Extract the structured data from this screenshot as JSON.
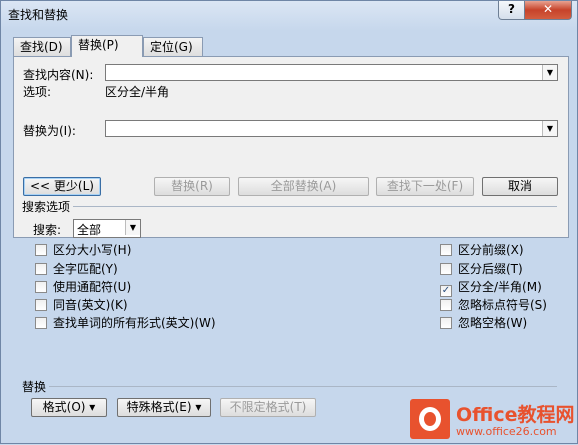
{
  "window": {
    "title": "查找和替换"
  },
  "titlebar": {
    "help": "?",
    "close": "✕"
  },
  "tabs": [
    {
      "label": "查找(D)"
    },
    {
      "label": "替换(P)"
    },
    {
      "label": "定位(G)"
    }
  ],
  "find": {
    "label": "查找内容(N):",
    "value": ""
  },
  "options": {
    "label": "选项:",
    "value": "区分全/半角"
  },
  "replace": {
    "label": "替换为(I):",
    "value": ""
  },
  "buttons": {
    "less": "<< 更少(L)",
    "replace": "替换(R)",
    "replace_all": "全部替换(A)",
    "find_next": "查找下一处(F)",
    "cancel": "取消"
  },
  "search_options": {
    "heading": "搜索选项",
    "search_label": "搜索:",
    "search_value": "全部"
  },
  "checkboxes_left": [
    {
      "label": "区分大小写(H)",
      "checked": false
    },
    {
      "label": "全字匹配(Y)",
      "checked": false
    },
    {
      "label": "使用通配符(U)",
      "checked": false
    },
    {
      "label": "同音(英文)(K)",
      "checked": false
    },
    {
      "label": "查找单词的所有形式(英文)(W)",
      "checked": false
    }
  ],
  "checkboxes_right": [
    {
      "label": "区分前缀(X)",
      "checked": false
    },
    {
      "label": "区分后缀(T)",
      "checked": false
    },
    {
      "label": "区分全/半角(M)",
      "checked": true
    },
    {
      "label": "忽略标点符号(S)",
      "checked": false
    },
    {
      "label": "忽略空格(W)",
      "checked": false
    }
  ],
  "replace_section": {
    "heading": "替换",
    "format_btn": "格式(O) ▾",
    "special_btn": "特殊格式(E) ▾",
    "no_format_btn": "不限定格式(T)"
  },
  "watermark": {
    "title": "Office教程网",
    "url": "www.office26.com"
  }
}
